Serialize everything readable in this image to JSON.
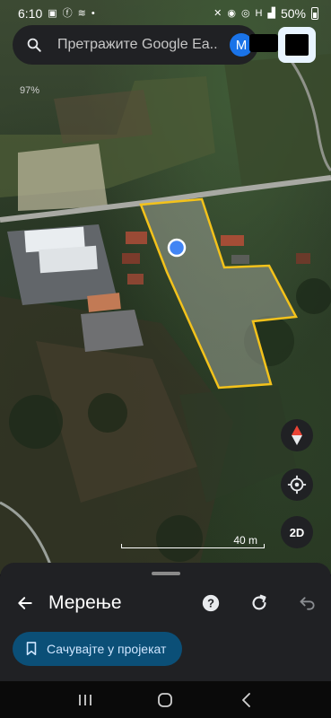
{
  "status_bar": {
    "time": "6:10",
    "battery": "50%",
    "left_icons": [
      "gallery-icon",
      "facebook-icon",
      "signal-waves-icon",
      "dot-icon"
    ],
    "right_icons": [
      "mute-icon",
      "location-icon",
      "hotspot-icon",
      "network-h-icon",
      "signal-icon",
      "battery-icon"
    ]
  },
  "search": {
    "placeholder": "Претражите Google Ea...",
    "avatar_initial": "M"
  },
  "map": {
    "zoom_label": "97%",
    "scale_label": "40 m",
    "controls": {
      "view_mode": "2D"
    },
    "polygon_color": "#f3c21b",
    "location_dot_color": "#4285f4"
  },
  "sheet": {
    "title": "Мерење",
    "save_label": "Сачувајте у пројекат",
    "accent": "#0b4f77"
  }
}
